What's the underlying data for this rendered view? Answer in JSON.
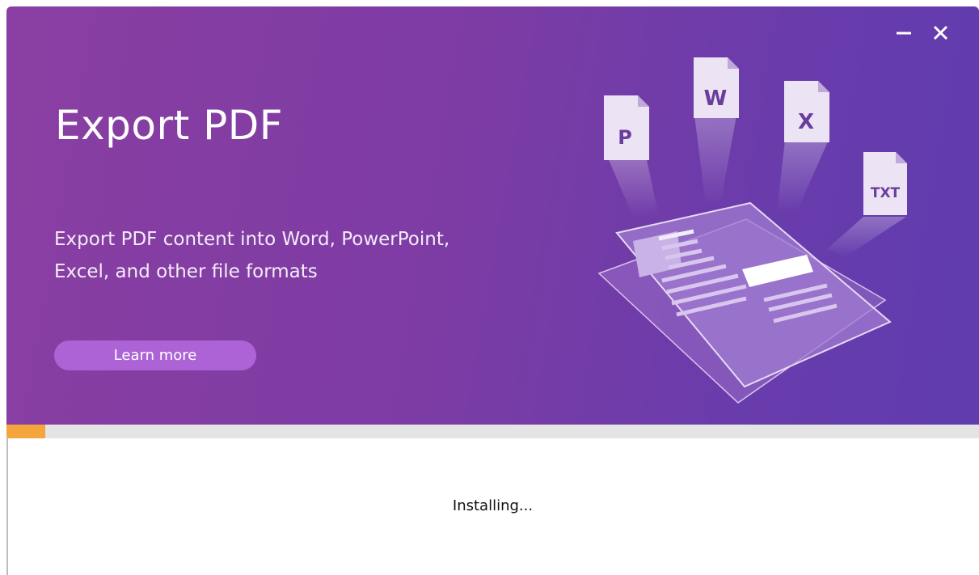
{
  "window": {
    "minimize_icon": "minimize-icon",
    "close_icon": "close-icon"
  },
  "banner": {
    "title": "Export PDF",
    "subtitle_line1": "Export PDF content into Word, PowerPoint,",
    "subtitle_line2": "Excel, and other file formats",
    "learn_more_label": "Learn more",
    "file_icons": [
      {
        "icon": "powerpoint-file-icon",
        "letter": "P"
      },
      {
        "icon": "word-file-icon",
        "letter": "W"
      },
      {
        "icon": "excel-file-icon",
        "letter": "X"
      },
      {
        "icon": "text-file-icon",
        "letter": "TXT"
      }
    ],
    "illustration": "pdf-document-illustration"
  },
  "colors": {
    "banner_start": "#8a3ea2",
    "banner_end": "#5f3caf",
    "button": "#ad63d6",
    "progress_fill": "#f4a53c",
    "progress_track": "#e4e4e4"
  },
  "progress": {
    "fraction": 0.04
  },
  "status": {
    "text": "Installing..."
  }
}
